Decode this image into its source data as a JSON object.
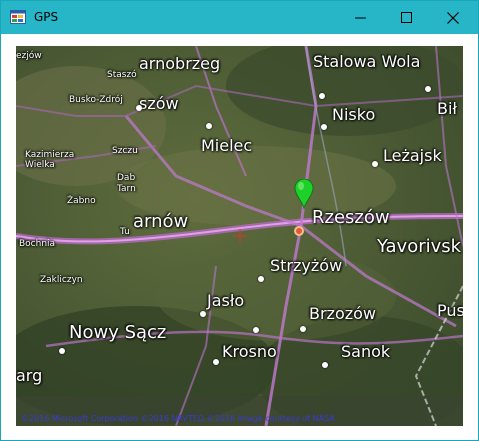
{
  "window": {
    "title": "GPS",
    "buttons": {
      "minimize": "minimize",
      "maximize": "maximize",
      "close": "close"
    }
  },
  "map": {
    "cities": {
      "stalowa_wola": "Stalowa Wola",
      "tarnobrzeg": "arnobrzeg",
      "staszow_a": "Staszó",
      "staszow_b": "szów",
      "jedrzejow": "ezjów",
      "busko": "Busko-Zdrój",
      "nisko": "Nisko",
      "bilgoraj": "Bił",
      "mielec": "Mielec",
      "lezajsk": "Leżajsk",
      "kazimierza": "Kazimierza\nWielka",
      "szczucin": "Szczu",
      "dabrowa_a": "Dab",
      "dabrowa_b": "Tarn",
      "zabno": "Żabno",
      "tarnow": "arnów",
      "rzeszow": "Rzeszów",
      "yavorivsk": "Yavorivsk",
      "bochnia": "Bochnia",
      "tuchow": "Tu",
      "strzyzow": "Strzyżów",
      "zakliczyn": "Zakliczyn",
      "jaslo": "Jasło",
      "brzozow": "Brzozów",
      "nowy_sacz": "Nowy Sącz",
      "krosno": "Krosno",
      "sanok": "Sanok",
      "przemysl": "Pus",
      "limanowa": "arg"
    },
    "copyright": "©2016 Microsoft Corporation  ©2016 NAVTEQ  ©2016 Image courtesy of NASA",
    "marker_color": "#1fd02a",
    "crosshair_color": "#e03030"
  }
}
